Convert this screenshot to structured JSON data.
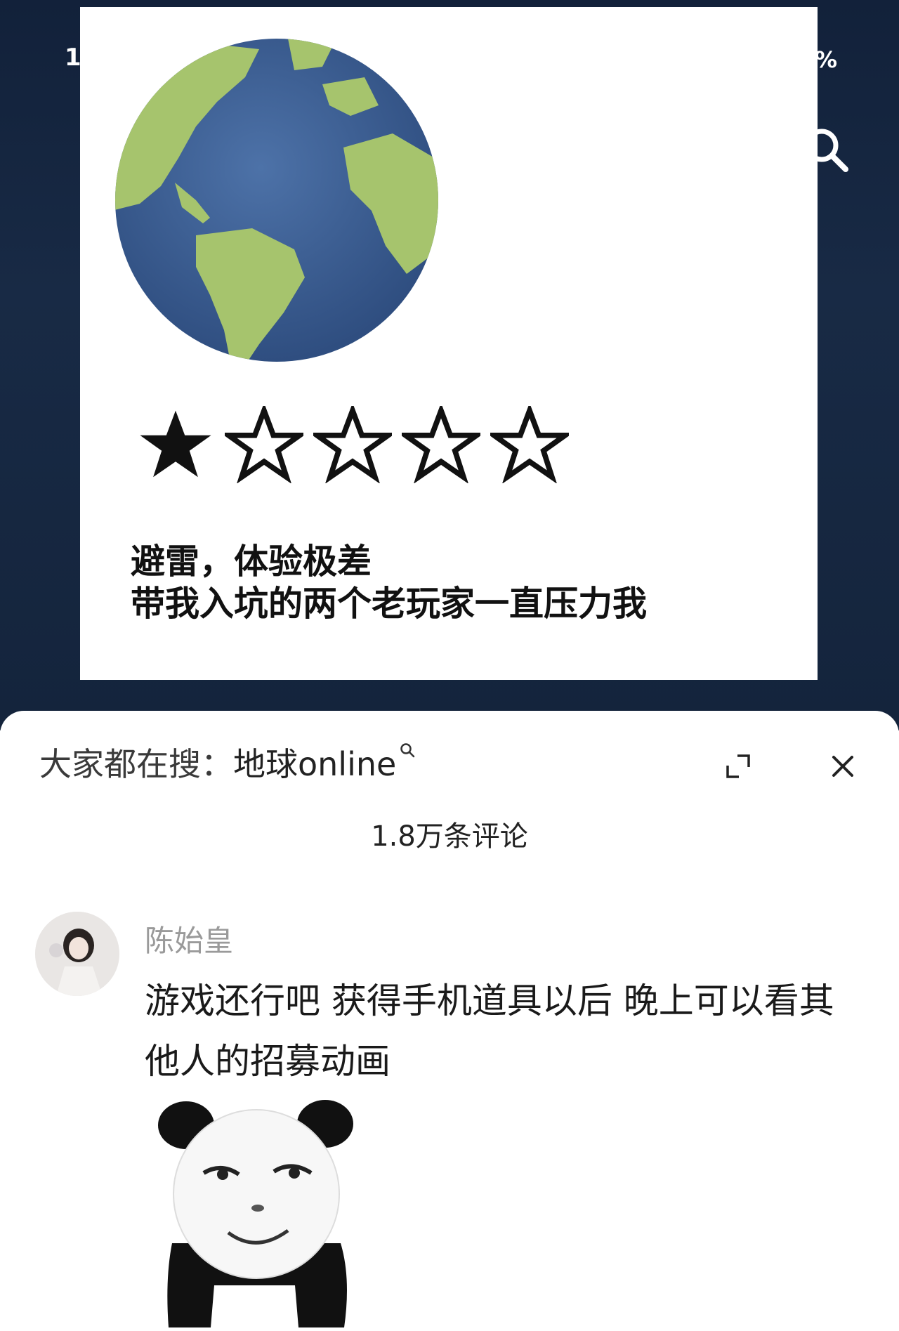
{
  "status_bar": {
    "time_partial": "1",
    "battery_partial": "%"
  },
  "post": {
    "rating": {
      "value": 1,
      "max": 5
    },
    "review_lines": [
      "避雷，体验极差",
      "带我入坑的两个老玩家一直压力我"
    ]
  },
  "comments_sheet": {
    "hot_search_prefix": "大家都在搜：",
    "hot_search_keyword": "地球online",
    "comment_count": "1.8万条评论",
    "comments": [
      {
        "username": "陈始皇",
        "text": "游戏还行吧  获得手机道具以后  晚上可以看其他人的招募动画"
      }
    ]
  },
  "icons": {
    "search": "search-icon",
    "expand": "expand-icon",
    "close": "close-icon",
    "globe": "globe-image",
    "sticker": "panda-meme-sticker"
  },
  "colors": {
    "video_background": "#12213a",
    "globe_ocean": "#3c5f96",
    "globe_land": "#a3c46a"
  }
}
